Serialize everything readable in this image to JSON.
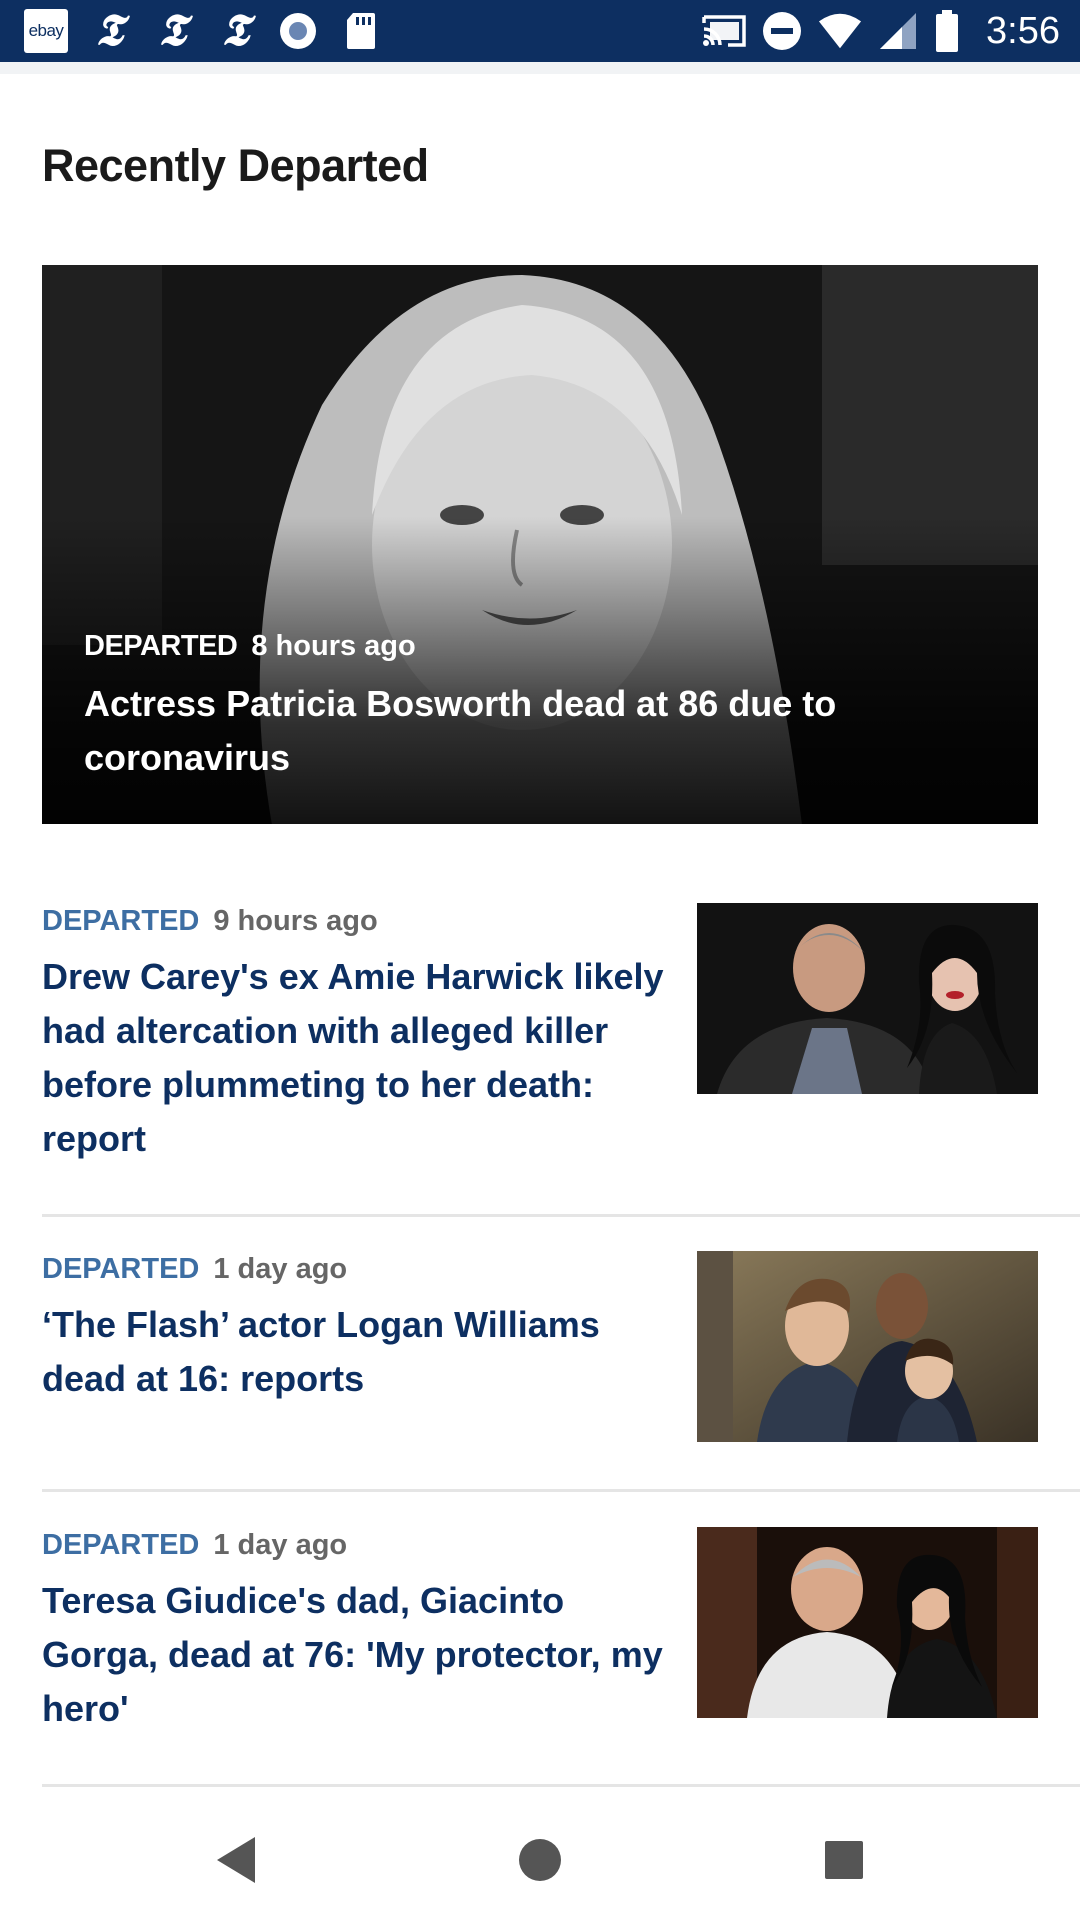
{
  "status_bar": {
    "ebay_label": "ebay",
    "nyt_glyph": "𝕿",
    "time": "3:56",
    "left_icons": [
      "ebay-app-icon",
      "nyt-icon",
      "nyt-icon",
      "nyt-icon",
      "record-icon",
      "sd-card-icon"
    ],
    "right_icons": [
      "cast-icon",
      "do-not-disturb-icon",
      "wifi-icon",
      "signal-icon",
      "battery-icon"
    ]
  },
  "page": {
    "title": "Recently Departed"
  },
  "hero": {
    "kicker": "DEPARTED",
    "time": "8 hours ago",
    "headline": "Actress Patricia Bosworth dead at 86 due to coronavirus"
  },
  "articles": [
    {
      "kicker": "DEPARTED",
      "time": "9 hours ago",
      "headline": "Drew Carey's ex Amie Harwick likely had altercation with alleged killer before plummeting to her death: report"
    },
    {
      "kicker": "DEPARTED",
      "time": "1 day ago",
      "headline": "‘The Flash’ actor Logan Williams dead at 16: reports"
    },
    {
      "kicker": "DEPARTED",
      "time": "1 day ago",
      "headline": "Teresa Giudice's dad, Giacinto Gorga, dead at 76: 'My protector, my hero'"
    }
  ],
  "nav_bar": {
    "buttons": [
      "back-icon",
      "home-icon",
      "recents-icon"
    ]
  },
  "colors": {
    "status_bar": "#0d2f61",
    "kicker_blue": "#3d6ea3",
    "headline_navy": "#0d2f61"
  }
}
